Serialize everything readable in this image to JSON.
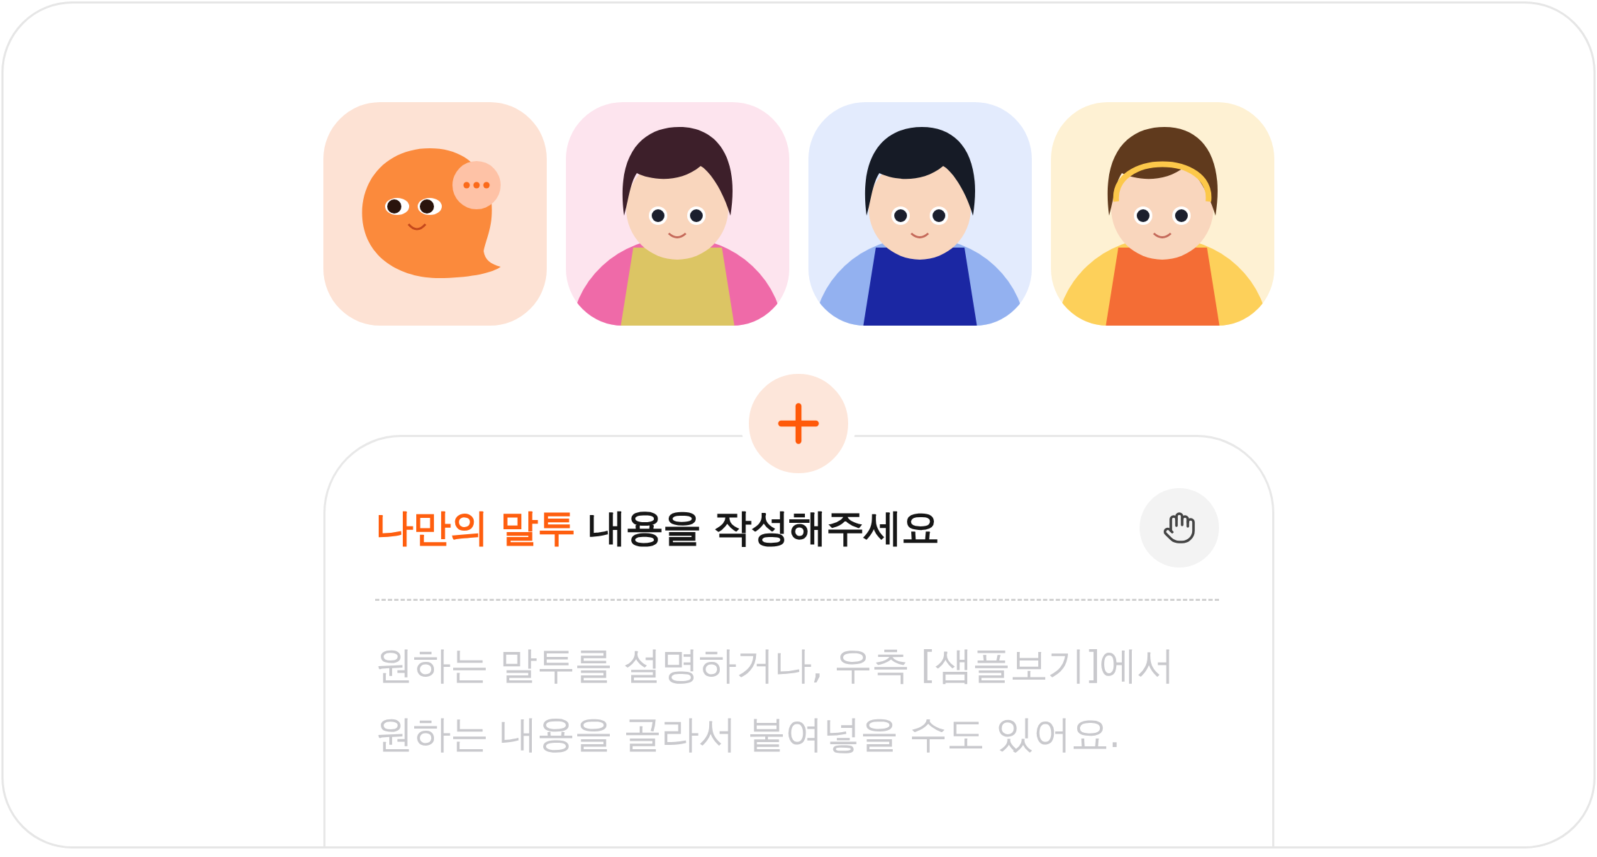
{
  "avatars": [
    {
      "kind": "bubble",
      "color": "#fde2d4"
    },
    {
      "kind": "woman",
      "color": "#fde4ee"
    },
    {
      "kind": "man",
      "color": "#e3ebfd"
    },
    {
      "kind": "girl",
      "color": "#fef1d3"
    }
  ],
  "editor": {
    "title": "**나만의 말투** 내용을 작성해주세요",
    "placeholder": "원하는 말투를 설명하거나, 우측 [샘플보기]에서\n원하는 내용을 골라서 붙여넣을 수도 있어요."
  }
}
